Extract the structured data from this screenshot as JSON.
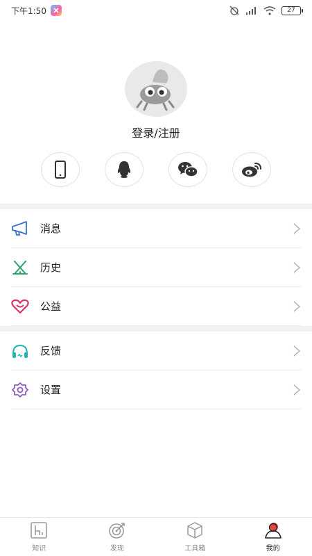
{
  "status_bar": {
    "time": "下午1:50",
    "battery": "27"
  },
  "profile": {
    "login_label": "登录/注册"
  },
  "social_logins": [
    {
      "name": "phone-icon"
    },
    {
      "name": "qq-icon"
    },
    {
      "name": "wechat-icon"
    },
    {
      "name": "weibo-icon"
    }
  ],
  "menu_group_1": [
    {
      "label": "消息",
      "icon": "megaphone-icon",
      "color": "#3b6fd1"
    },
    {
      "label": "历史",
      "icon": "tent-icon",
      "color": "#2aa36a"
    },
    {
      "label": "公益",
      "icon": "heart-icon",
      "color": "#d8336b"
    }
  ],
  "menu_group_2": [
    {
      "label": "反馈",
      "icon": "headphones-icon",
      "color": "#1fb3b3"
    },
    {
      "label": "设置",
      "icon": "gear-icon",
      "color": "#8b5cc6"
    }
  ],
  "tab_bar": {
    "tabs": [
      {
        "label": "知识",
        "icon": "book-icon"
      },
      {
        "label": "发现",
        "icon": "target-icon"
      },
      {
        "label": "工具箱",
        "icon": "box-icon"
      },
      {
        "label": "我的",
        "icon": "user-icon",
        "active": true
      }
    ]
  }
}
